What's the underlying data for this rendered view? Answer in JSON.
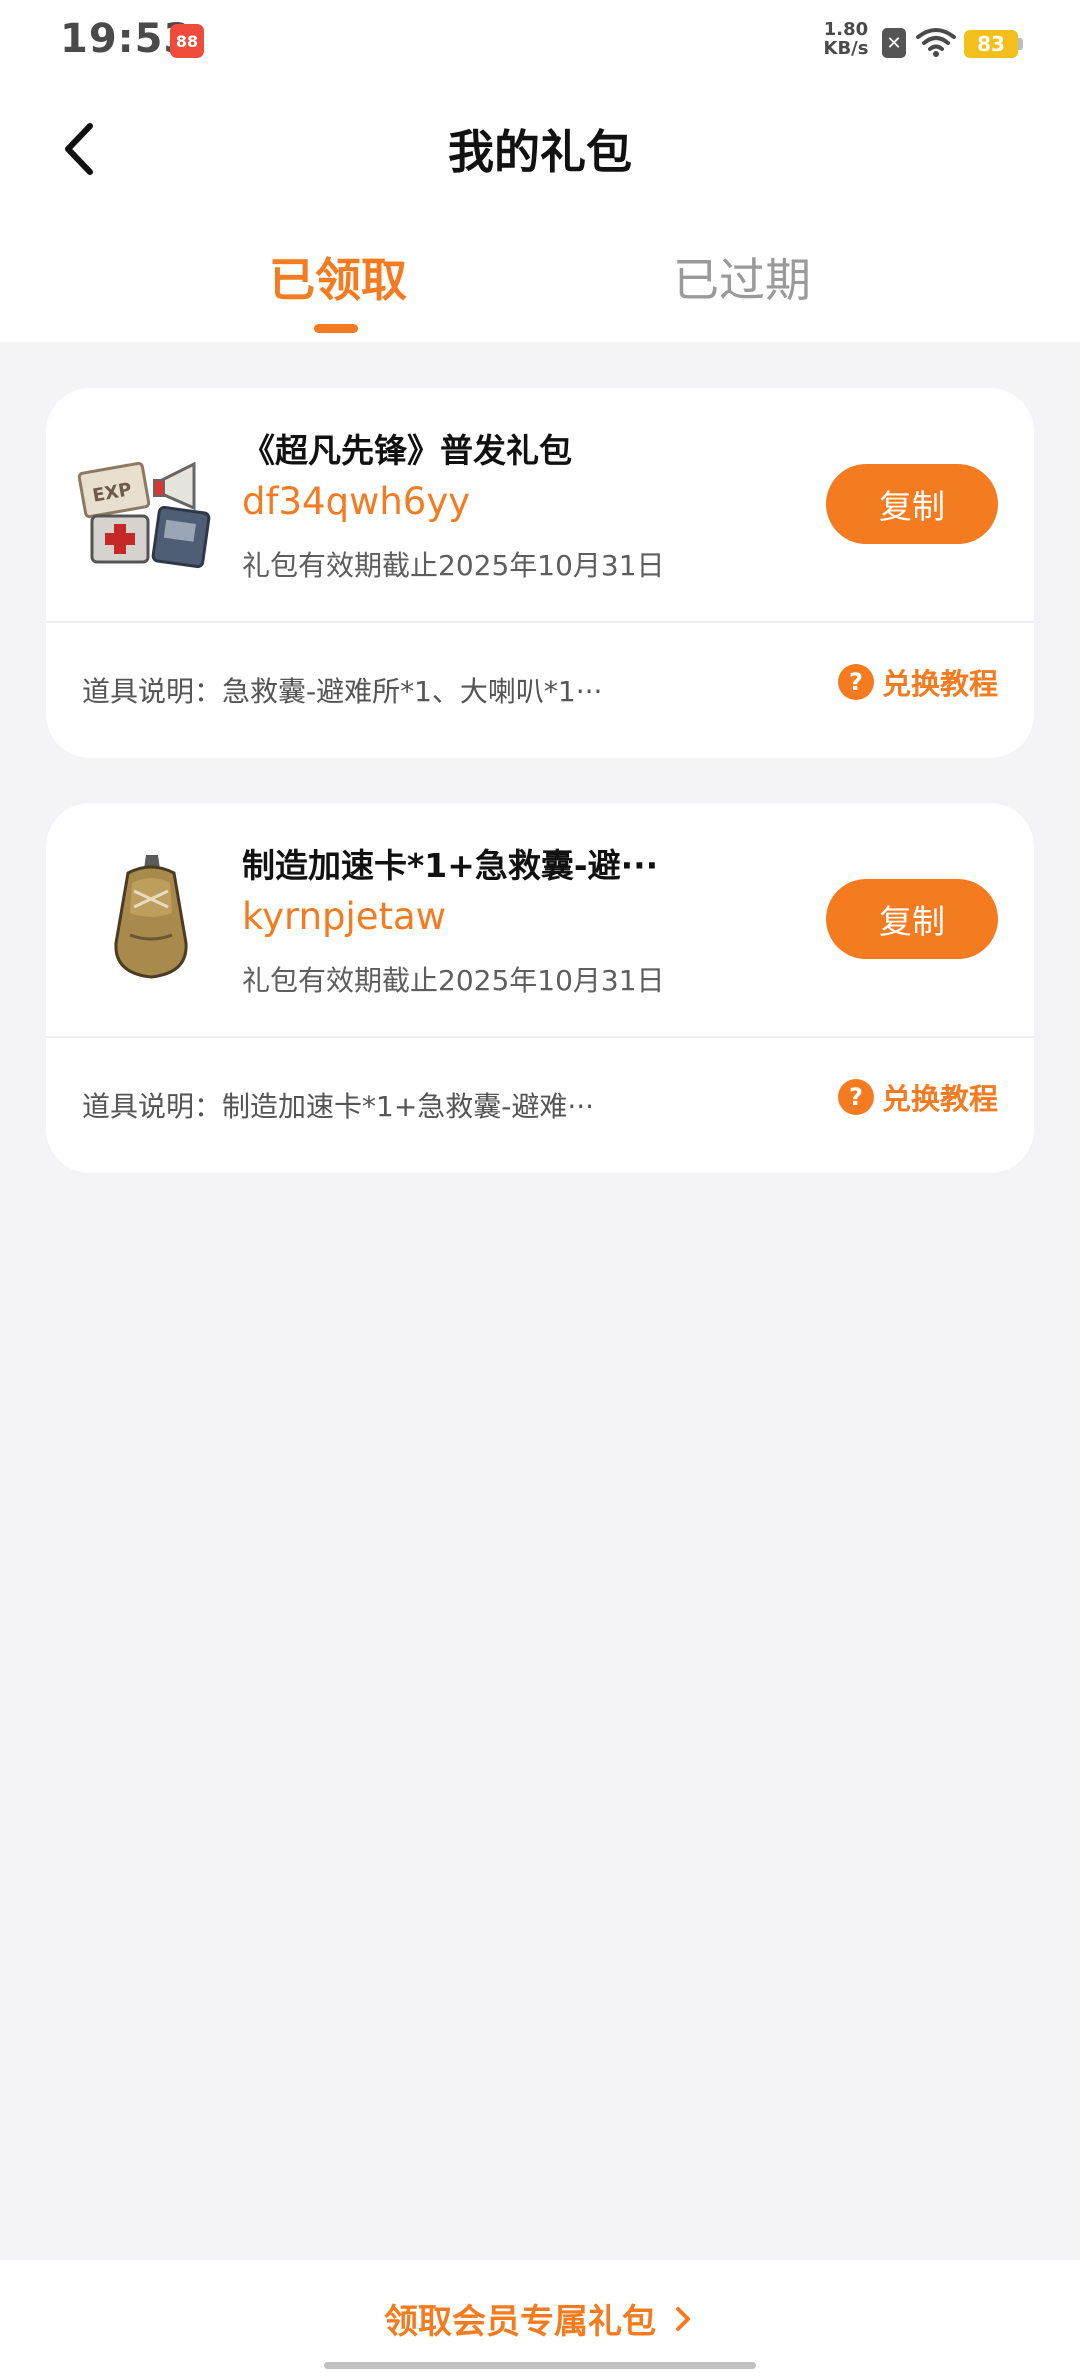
{
  "status_bar": {
    "time": "19:53",
    "app_badge": "88",
    "net_speed_value": "1.80",
    "net_speed_unit": "KB/s",
    "battery": "83"
  },
  "header": {
    "title": "我的礼包"
  },
  "tabs": [
    {
      "label": "已领取",
      "active": true
    },
    {
      "label": "已过期",
      "active": false
    }
  ],
  "gifts": [
    {
      "name": "《超凡先锋》普发礼包",
      "code": "df34qwh6yy",
      "expiry": "礼包有效期截止2025年10月31日",
      "copy_label": "复制",
      "description": "道具说明：急救囊-避难所*1、大喇叭*1···",
      "tutorial_label": "兑换教程",
      "image": "item-bundle-image"
    },
    {
      "name": "制造加速卡*1+急救囊-避···",
      "code": "kyrnpjetaw",
      "expiry": "礼包有效期截止2025年10月31日",
      "copy_label": "复制",
      "description": "道具说明：制造加速卡*1+急救囊-避难···",
      "tutorial_label": "兑换教程",
      "image": "aid-pouch-image"
    }
  ],
  "footer": {
    "member_link": "领取会员专属礼包"
  },
  "colors": {
    "accent": "#f57b20",
    "background": "#f4f4f6",
    "card": "#ffffff",
    "inactive_tab": "#9a9a9a"
  }
}
